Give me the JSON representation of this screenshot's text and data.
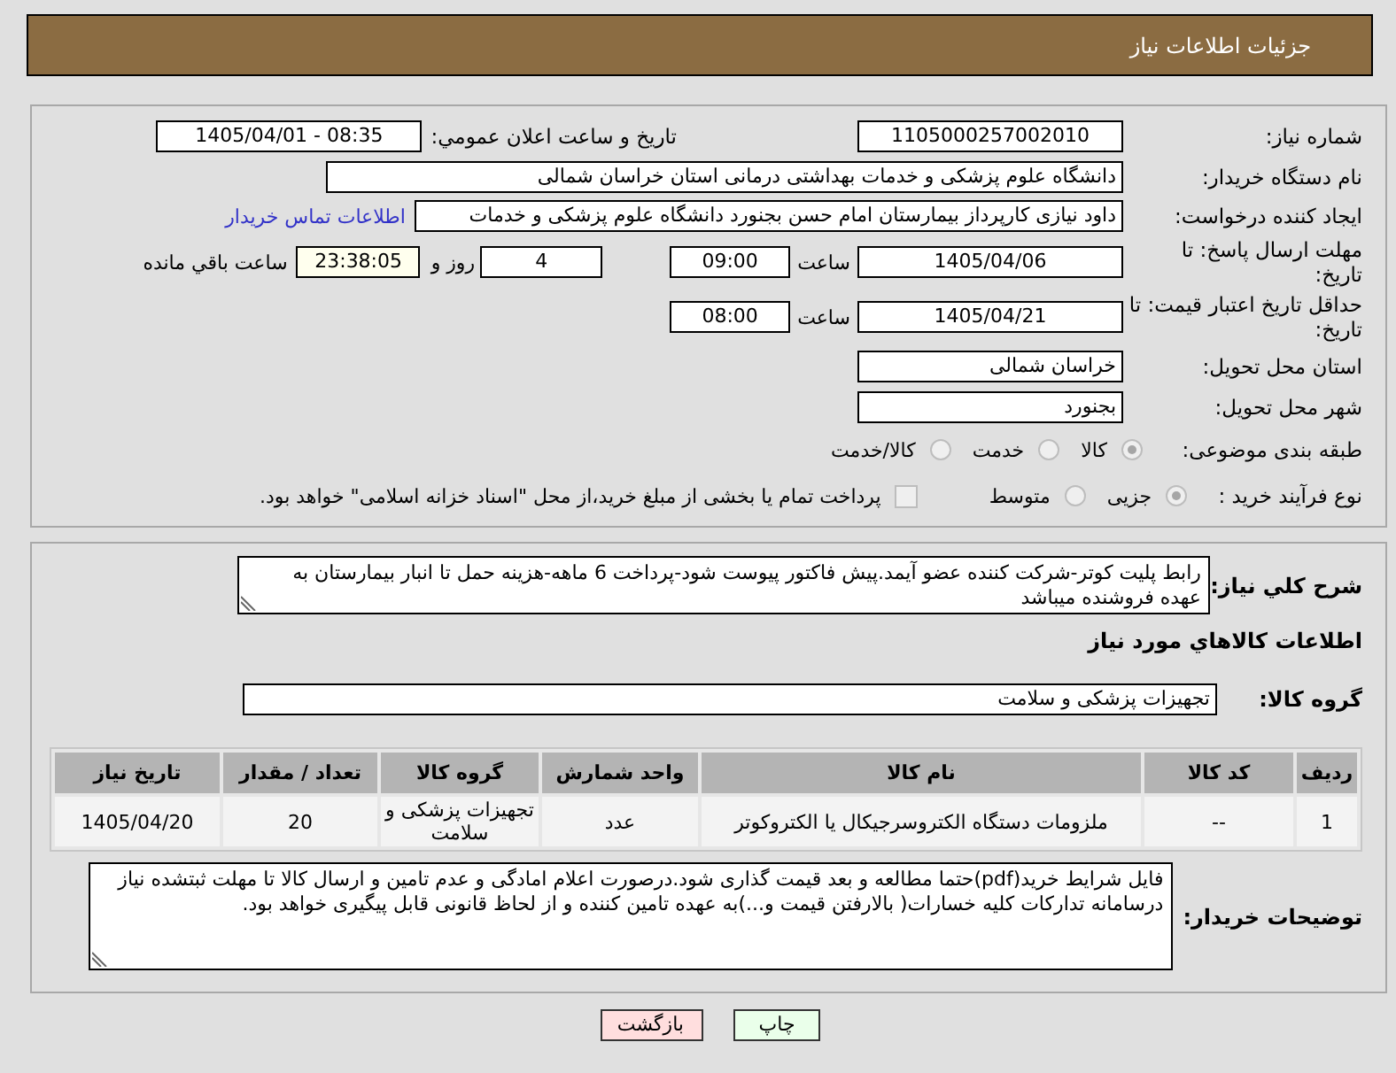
{
  "header": {
    "title": "جزئیات اطلاعات نیاز"
  },
  "details": {
    "need_number": {
      "label": "شماره نیاز:",
      "value": "1105000257002010"
    },
    "announcement": {
      "label": "تاريخ و ساعت اعلان عمومي:",
      "value": "1405/04/01 - 08:35"
    },
    "buyer": {
      "label": "نام دستگاه خریدار:",
      "value": "دانشگاه علوم پزشکی و خدمات بهداشتی درمانی استان خراسان شمالی"
    },
    "requester": {
      "label": "ایجاد کننده درخواست:",
      "value": "داود نیازی کارپرداز بیمارستان امام حسن بجنورد دانشگاه علوم پزشکی و خدمات",
      "contact_link": "اطلاعات تماس خریدار"
    },
    "reply_deadline": {
      "label": "مهلت ارسال پاسخ: تا تاریخ:",
      "date": "1405/04/06",
      "time_label": "ساعت",
      "time": "09:00",
      "days": "4",
      "days_label": "روز و",
      "remaining": "23:38:05",
      "remaining_label": "ساعت باقي مانده"
    },
    "price_validity": {
      "label": "حداقل تاریخ اعتبار قیمت: تا تاریخ:",
      "date": "1405/04/21",
      "time_label": "ساعت",
      "time": "08:00"
    },
    "delivery_province": {
      "label": "استان محل تحویل:",
      "value": "خراسان شمالی"
    },
    "delivery_city": {
      "label": "شهر محل تحویل:",
      "value": "بجنورد"
    },
    "category": {
      "label": "طبقه بندی موضوعی:",
      "options": [
        {
          "label": "کالا",
          "selected": true,
          "disabled": true
        },
        {
          "label": "خدمت",
          "selected": false,
          "disabled": true
        },
        {
          "label": "کالا/خدمت",
          "selected": false,
          "disabled": true
        }
      ]
    },
    "purchase_type": {
      "label": "نوع فرآیند خرید :",
      "options": [
        {
          "label": "جزیی",
          "selected": true,
          "disabled": true
        },
        {
          "label": "متوسط",
          "selected": false,
          "disabled": true
        }
      ],
      "treasury": {
        "label": "پرداخت تمام یا بخشی از مبلغ خرید،از محل \"اسناد خزانه اسلامی\" خواهد بود.",
        "checked": false,
        "disabled": true
      }
    }
  },
  "items": {
    "description": {
      "label": "شرح کلي نياز:",
      "value": "رابط پلیت کوتر-شرکت کننده عضو آیمد.پیش فاکتور پیوست شود-پرداخت 6 ماهه-هزینه حمل تا انبار بیمارستان به عهده فروشنده میباشد"
    },
    "section_title": "اطلاعات کالاهاي مورد نياز",
    "goods_group": {
      "label": "گروه کالا:",
      "value": "تجهیزات پزشکی و سلامت"
    },
    "table": {
      "columns": [
        "ردیف",
        "کد کالا",
        "نام کالا",
        "واحد شمارش",
        "گروه کالا",
        "تعداد / مقدار",
        "تاریخ نیاز"
      ],
      "rows": [
        [
          "1",
          "--",
          "ملزومات دستگاه الکتروسرجیکال یا الکتروکوتر",
          "عدد",
          "تجهیزات پزشکی و سلامت",
          "20",
          "1405/04/20"
        ]
      ]
    },
    "buyer_notes": {
      "label": "توضیحات خریدار:",
      "value": "فایل شرایط خرید(pdf)حتما مطالعه و بعد قیمت گذاری شود.درصورت اعلام امادگی و عدم تامین و ارسال کالا تا مهلت ثبتشده نیاز درسامانه تدارکات کلیه خسارات( بالارفتن قیمت و...)به عهده تامین کننده و از لحاظ قانونی قابل پیگیری خواهد بود."
    }
  },
  "buttons": [
    {
      "label": "چاپ",
      "kind": "print"
    },
    {
      "label": "بازگشت",
      "kind": "back"
    }
  ]
}
